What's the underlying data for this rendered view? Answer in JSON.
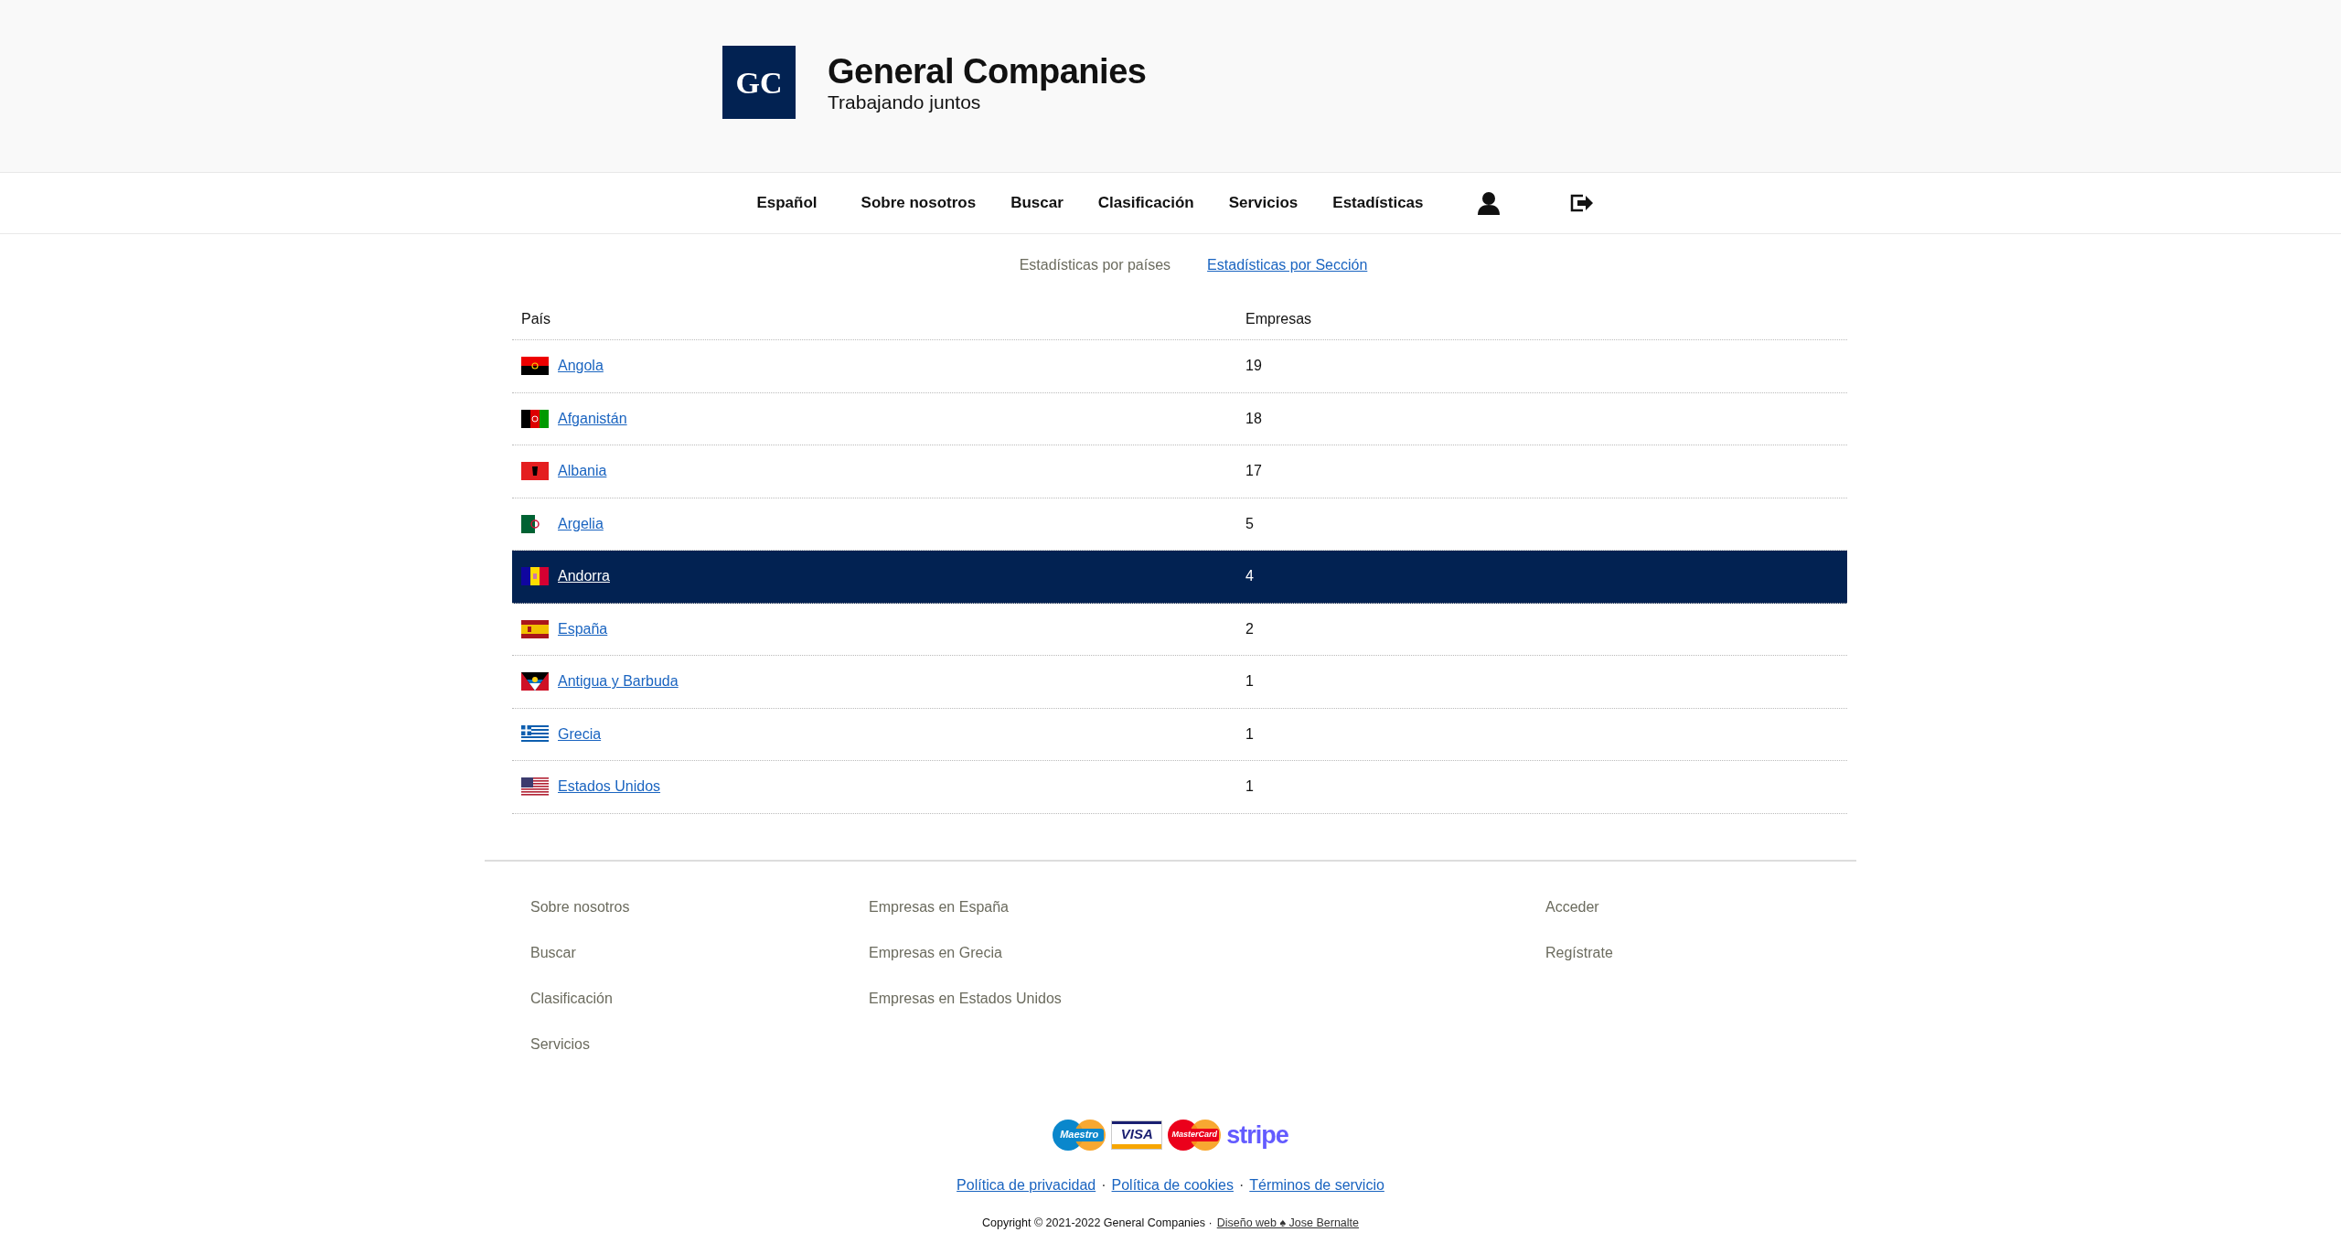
{
  "brand": {
    "logo": "GC",
    "name": "General Companies",
    "tagline": "Trabajando juntos"
  },
  "nav": {
    "items": [
      "Español",
      "Sobre nosotros",
      "Buscar",
      "Clasificación",
      "Servicios",
      "Estadísticas"
    ]
  },
  "subtabs": [
    {
      "label": "Estadísticas por países",
      "selected": true
    },
    {
      "label": "Estadísticas por Sección",
      "selected": false
    }
  ],
  "table": {
    "columns": [
      "País",
      "Empresas"
    ],
    "rows": [
      {
        "country": "Angola",
        "count": "19",
        "selected": false
      },
      {
        "country": "Afganistán",
        "count": "18",
        "selected": false
      },
      {
        "country": "Albania",
        "count": "17",
        "selected": false
      },
      {
        "country": "Argelia",
        "count": "5",
        "selected": false
      },
      {
        "country": "Andorra",
        "count": "4",
        "selected": true
      },
      {
        "country": "España",
        "count": "2",
        "selected": false
      },
      {
        "country": "Antigua y Barbuda",
        "count": "1",
        "selected": false
      },
      {
        "country": "Grecia",
        "count": "1",
        "selected": false
      },
      {
        "country": "Estados Unidos",
        "count": "1",
        "selected": false
      }
    ]
  },
  "footer": {
    "columns": [
      [
        "Sobre nosotros",
        "Buscar",
        "Clasificación",
        "Servicios"
      ],
      [
        "Empresas en España",
        "Empresas en Grecia",
        "Empresas en Estados Unidos"
      ],
      [
        "Acceder",
        "Regístrate"
      ]
    ],
    "payment_logos": [
      "Maestro",
      "VISA",
      "MasterCard",
      "stripe"
    ],
    "legal_links": [
      "Política de privacidad",
      "Política de cookies",
      "Términos de servicio"
    ],
    "separator": "·",
    "copyright": "Copyright © 2021-2022 General Companies ·",
    "credit": "Diseño web ♠ Jose Bernalte"
  }
}
